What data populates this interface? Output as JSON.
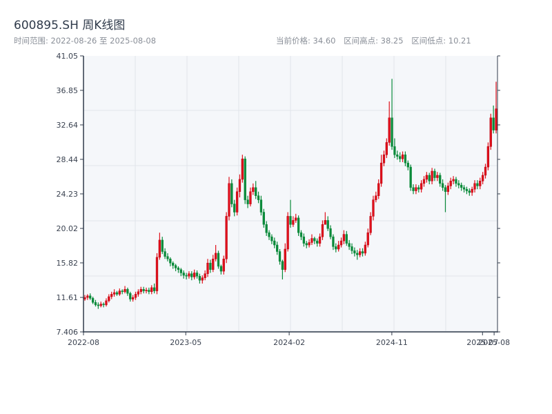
{
  "header": {
    "title": "600895.SH 周K线图",
    "range_label": "时间范围: 2022-08-26 至 2025-08-08",
    "current_price": "当前价格: 34.60",
    "range_high": "区间高点: 38.25",
    "range_low": "区间低点: 10.21"
  },
  "colors": {
    "up": "#e0101b",
    "down": "#0a8a3a",
    "plot_bg": "#f5f7fa",
    "grid": "#e1e4ea",
    "axis": "#2f3a4a"
  },
  "chart_data": {
    "type": "candlestick",
    "frequency": "weekly",
    "date_range": [
      "2022-08-26",
      "2025-08-08"
    ],
    "ylim": [
      7.406,
      41.05
    ],
    "y_ticks": [
      "7.406",
      "11.61",
      "15.82",
      "20.02",
      "24.23",
      "28.44",
      "32.64",
      "36.85",
      "41.05"
    ],
    "x_ticks": [
      {
        "label": "2022-08",
        "date": "2022-08-01"
      },
      {
        "label": "2023-05",
        "date": "2023-05-01"
      },
      {
        "label": "2024-02",
        "date": "2024-02-01"
      },
      {
        "label": "2024-11",
        "date": "2024-11-01"
      },
      {
        "label": "2025-07",
        "date": "2025-07-01"
      },
      {
        "label": "2025-08",
        "date": "2025-08-01"
      }
    ],
    "grid": true,
    "close": [
      11.6,
      11.8,
      11.5,
      11.0,
      10.7,
      10.6,
      10.8,
      10.7,
      11.2,
      11.7,
      12.0,
      12.2,
      12.0,
      12.4,
      12.3,
      12.6,
      12.1,
      11.4,
      11.6,
      12.0,
      12.3,
      12.6,
      12.4,
      12.5,
      12.3,
      12.8,
      12.4,
      16.5,
      18.6,
      17.2,
      16.6,
      16.3,
      15.8,
      15.5,
      15.2,
      15.0,
      14.6,
      14.3,
      14.2,
      14.5,
      14.1,
      14.6,
      14.2,
      13.7,
      14.0,
      14.5,
      15.8,
      15.0,
      16.3,
      17.0,
      15.4,
      14.8,
      16.3,
      21.5,
      25.5,
      23.0,
      22.0,
      24.5,
      26.0,
      28.5,
      23.5,
      23.0,
      24.5,
      25.0,
      24.0,
      23.5,
      22.0,
      20.5,
      19.5,
      19.0,
      18.5,
      18.0,
      17.2,
      16.0,
      15.0,
      17.5,
      21.5,
      20.5,
      21.0,
      21.3,
      19.5,
      19.0,
      18.2,
      18.0,
      18.3,
      18.8,
      18.5,
      18.2,
      19.0,
      20.5,
      21.0,
      20.0,
      19.0,
      17.8,
      17.5,
      18.0,
      18.5,
      19.3,
      18.2,
      17.8,
      17.3,
      17.0,
      16.8,
      17.2,
      17.0,
      18.0,
      19.5,
      21.5,
      23.5,
      24.0,
      25.5,
      28.0,
      29.0,
      30.5,
      33.5,
      30.0,
      29.0,
      28.8,
      28.5,
      29.0,
      28.0,
      27.5,
      25.0,
      24.6,
      25.0,
      24.8,
      25.5,
      26.0,
      26.5,
      25.8,
      27.0,
      26.2,
      26.5,
      25.5,
      25.0,
      24.5,
      25.2,
      25.8,
      26.0,
      25.5,
      25.3,
      25.0,
      24.8,
      24.6,
      24.4,
      24.8,
      25.5,
      25.2,
      25.8,
      26.5,
      27.5,
      30.0,
      33.5,
      32.0,
      34.6
    ],
    "open": [
      11.4,
      11.6,
      11.8,
      11.5,
      11.0,
      10.7,
      10.6,
      10.8,
      10.7,
      11.2,
      11.7,
      12.0,
      12.2,
      12.0,
      12.4,
      12.3,
      12.6,
      12.1,
      11.4,
      11.6,
      12.0,
      12.3,
      12.6,
      12.4,
      12.5,
      12.3,
      12.8,
      12.4,
      16.5,
      18.6,
      17.2,
      16.6,
      16.3,
      15.8,
      15.5,
      15.2,
      15.0,
      14.6,
      14.3,
      14.2,
      14.5,
      14.1,
      14.6,
      14.2,
      13.7,
      14.0,
      14.5,
      15.8,
      15.0,
      16.3,
      17.0,
      15.4,
      14.8,
      16.3,
      21.5,
      25.5,
      23.0,
      22.0,
      24.5,
      26.0,
      28.5,
      23.5,
      23.0,
      24.5,
      25.0,
      24.0,
      23.5,
      22.0,
      20.5,
      19.5,
      19.0,
      18.5,
      18.0,
      17.2,
      16.0,
      15.0,
      17.5,
      21.5,
      20.5,
      21.0,
      21.3,
      19.5,
      19.0,
      18.2,
      18.0,
      18.3,
      18.8,
      18.5,
      18.2,
      19.0,
      20.5,
      21.0,
      20.0,
      19.0,
      17.8,
      17.5,
      18.0,
      18.5,
      19.3,
      18.2,
      17.8,
      17.3,
      17.0,
      16.8,
      17.2,
      17.0,
      18.0,
      19.5,
      21.5,
      23.5,
      24.0,
      25.5,
      28.0,
      29.0,
      30.5,
      33.5,
      30.0,
      29.0,
      28.8,
      28.5,
      29.0,
      28.0,
      27.5,
      25.0,
      24.6,
      25.0,
      24.8,
      25.5,
      26.0,
      26.5,
      25.8,
      27.0,
      26.2,
      26.5,
      25.5,
      25.0,
      24.5,
      25.2,
      25.8,
      26.0,
      25.5,
      25.3,
      25.0,
      24.8,
      24.6,
      24.4,
      24.8,
      25.5,
      25.2,
      25.8,
      26.5,
      27.5,
      30.0,
      33.5,
      32.0
    ],
    "high": [
      11.9,
      12.0,
      12.1,
      11.7,
      11.3,
      11.0,
      11.1,
      11.0,
      11.5,
      12.0,
      12.3,
      12.6,
      12.4,
      12.7,
      12.6,
      13.0,
      12.8,
      12.3,
      11.9,
      12.3,
      12.6,
      12.9,
      12.9,
      12.8,
      12.8,
      13.1,
      13.3,
      17.0,
      19.5,
      19.0,
      17.6,
      17.0,
      16.5,
      16.0,
      15.7,
      15.4,
      15.2,
      14.9,
      14.6,
      14.8,
      14.8,
      15.0,
      14.9,
      14.5,
      14.3,
      14.9,
      16.3,
      16.2,
      16.8,
      18.0,
      17.3,
      15.6,
      16.7,
      22.0,
      26.3,
      26.0,
      23.5,
      25.0,
      26.6,
      29.0,
      28.8,
      24.0,
      25.0,
      25.5,
      25.8,
      24.5,
      24.0,
      22.4,
      20.9,
      19.8,
      19.3,
      18.9,
      18.4,
      17.5,
      16.2,
      18.2,
      22.0,
      23.5,
      21.5,
      21.8,
      21.6,
      19.8,
      19.4,
      18.5,
      18.7,
      19.3,
      19.0,
      18.8,
      19.4,
      21.0,
      22.0,
      21.5,
      20.4,
      19.3,
      18.2,
      18.5,
      18.9,
      19.8,
      19.7,
      18.6,
      18.2,
      17.7,
      17.4,
      17.6,
      17.6,
      18.4,
      20.0,
      22.0,
      24.0,
      24.5,
      26.0,
      29.0,
      29.5,
      31.0,
      35.5,
      38.25,
      31.0,
      29.5,
      29.3,
      29.4,
      29.4,
      28.3,
      27.8,
      25.4,
      25.4,
      25.3,
      25.9,
      26.4,
      26.9,
      26.8,
      27.4,
      27.3,
      26.9,
      26.8,
      26.0,
      25.3,
      25.6,
      26.2,
      26.4,
      26.3,
      25.9,
      25.6,
      25.3,
      25.1,
      24.9,
      25.1,
      25.9,
      25.9,
      26.2,
      26.9,
      27.9,
      30.5,
      34.0,
      35.0,
      37.9
    ],
    "low": [
      11.2,
      11.3,
      11.3,
      10.8,
      10.5,
      10.21,
      10.4,
      10.4,
      10.5,
      11.0,
      11.4,
      11.7,
      11.8,
      11.8,
      12.0,
      12.1,
      11.8,
      11.1,
      11.1,
      11.3,
      11.7,
      12.0,
      12.1,
      12.1,
      12.0,
      12.0,
      12.1,
      12.0,
      16.2,
      16.9,
      16.3,
      16.0,
      15.4,
      15.1,
      14.8,
      14.6,
      14.2,
      13.9,
      13.8,
      13.9,
      13.7,
      13.8,
      13.9,
      13.3,
      13.3,
      13.7,
      14.1,
      14.6,
      14.7,
      16.0,
      15.1,
      14.4,
      14.4,
      15.8,
      21.0,
      22.6,
      21.5,
      21.6,
      23.8,
      25.6,
      23.0,
      22.5,
      22.7,
      24.1,
      23.6,
      23.1,
      21.6,
      20.1,
      19.1,
      18.6,
      18.1,
      17.6,
      16.8,
      15.6,
      13.8,
      14.7,
      17.2,
      20.1,
      20.2,
      20.7,
      19.1,
      18.6,
      17.8,
      17.6,
      17.7,
      18.0,
      18.1,
      17.8,
      17.8,
      18.6,
      20.6,
      19.7,
      18.7,
      17.4,
      17.1,
      17.2,
      17.7,
      18.1,
      17.9,
      17.4,
      16.9,
      16.6,
      16.2,
      16.5,
      16.6,
      16.7,
      17.7,
      19.2,
      21.0,
      23.2,
      23.6,
      25.1,
      27.6,
      28.6,
      30.1,
      29.6,
      28.6,
      28.4,
      28.1,
      28.1,
      27.6,
      27.1,
      24.6,
      24.2,
      24.2,
      24.4,
      24.4,
      25.1,
      25.6,
      25.4,
      25.4,
      25.8,
      25.8,
      25.1,
      24.6,
      22.0,
      24.1,
      24.8,
      25.4,
      25.1,
      24.9,
      24.6,
      24.4,
      24.2,
      24.0,
      24.0,
      24.4,
      24.8,
      24.8,
      25.4,
      26.1,
      27.1,
      29.6,
      31.6,
      31.6
    ]
  }
}
